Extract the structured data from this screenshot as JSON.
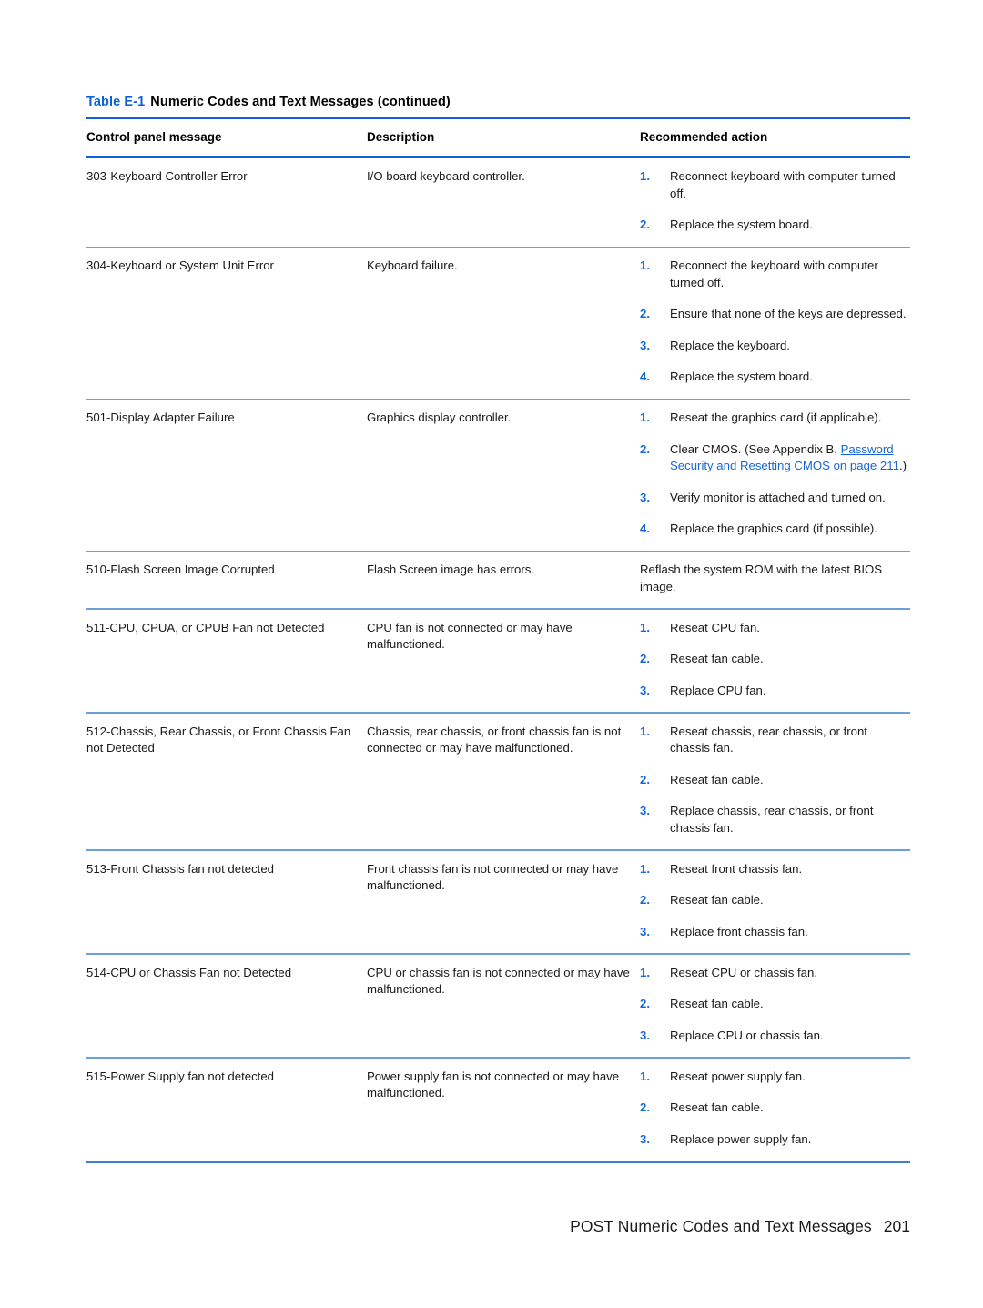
{
  "document": {
    "footer": {
      "section_title": "POST Numeric Codes and Text Messages",
      "page_number": "201"
    }
  },
  "colors": {
    "accent_blue": "#1260d8",
    "caption_blue": "#0b62d8",
    "list_number_blue": "#1567d3",
    "link_blue": "#1567d3",
    "row_rule": "#6f9fd8",
    "bottom_rule": "#3f7fcf",
    "text": "#1a1a1a"
  },
  "table": {
    "caption_number": "Table E-1",
    "caption_title": "Numeric Codes and Text Messages (continued)",
    "headers": {
      "message": "Control panel message",
      "description": "Description",
      "action": "Recommended action"
    },
    "rows": [
      {
        "message": "303-Keyboard Controller Error",
        "description": "I/O board keyboard controller.",
        "actions": [
          {
            "num": "1.",
            "text": "Reconnect keyboard with computer turned off."
          },
          {
            "num": "2.",
            "text": "Replace the system board."
          }
        ]
      },
      {
        "message": "304-Keyboard or System Unit Error",
        "description": "Keyboard failure.",
        "actions": [
          {
            "num": "1.",
            "text": "Reconnect the keyboard with computer turned off."
          },
          {
            "num": "2.",
            "text": "Ensure that none of the keys are depressed."
          },
          {
            "num": "3.",
            "text": "Replace the keyboard."
          },
          {
            "num": "4.",
            "text": "Replace the system board."
          }
        ]
      },
      {
        "message": "501-Display Adapter Failure",
        "description": "Graphics display controller.",
        "actions": [
          {
            "num": "1.",
            "text": "Reseat the graphics card (if applicable)."
          },
          {
            "num": "2.",
            "text_before": "Clear CMOS. (See Appendix B, ",
            "link": "Password Security and Resetting CMOS on page 211",
            "text_after": ".)"
          },
          {
            "num": "3.",
            "text": "Verify monitor is attached and turned on."
          },
          {
            "num": "4.",
            "text": "Replace the graphics card (if possible)."
          }
        ]
      },
      {
        "message": "510-Flash Screen Image Corrupted",
        "description": "Flash Screen image has errors.",
        "action_plain": "Reflash the system ROM with the latest BIOS image."
      },
      {
        "message": "511-CPU, CPUA, or CPUB Fan not Detected",
        "description": "CPU fan is not connected or may have malfunctioned.",
        "actions": [
          {
            "num": "1.",
            "text": "Reseat CPU fan."
          },
          {
            "num": "2.",
            "text": "Reseat fan cable."
          },
          {
            "num": "3.",
            "text": "Replace CPU fan."
          }
        ]
      },
      {
        "message": "512-Chassis, Rear Chassis, or Front Chassis Fan not Detected",
        "description": "Chassis, rear chassis, or front chassis fan is not connected or may have malfunctioned.",
        "actions": [
          {
            "num": "1.",
            "text": "Reseat chassis, rear chassis, or front chassis fan."
          },
          {
            "num": "2.",
            "text": "Reseat fan cable."
          },
          {
            "num": "3.",
            "text": "Replace chassis, rear chassis, or front chassis fan."
          }
        ]
      },
      {
        "message": "513-Front Chassis fan not detected",
        "description": "Front chassis fan is not connected or may have malfunctioned.",
        "actions": [
          {
            "num": "1.",
            "text": "Reseat front chassis fan."
          },
          {
            "num": "2.",
            "text": "Reseat fan cable."
          },
          {
            "num": "3.",
            "text": "Replace front chassis fan."
          }
        ]
      },
      {
        "message": "514-CPU or Chassis Fan not Detected",
        "description": "CPU or chassis fan is not connected or may have malfunctioned.",
        "actions": [
          {
            "num": "1.",
            "text": "Reseat CPU or chassis fan."
          },
          {
            "num": "2.",
            "text": "Reseat fan cable."
          },
          {
            "num": "3.",
            "text": "Replace CPU or chassis fan."
          }
        ]
      },
      {
        "message": "515-Power Supply fan not detected",
        "description": "Power supply fan is not connected or may have malfunctioned.",
        "actions": [
          {
            "num": "1.",
            "text": "Reseat power supply fan."
          },
          {
            "num": "2.",
            "text": "Reseat fan cable."
          },
          {
            "num": "3.",
            "text": "Replace power supply fan."
          }
        ]
      }
    ]
  }
}
